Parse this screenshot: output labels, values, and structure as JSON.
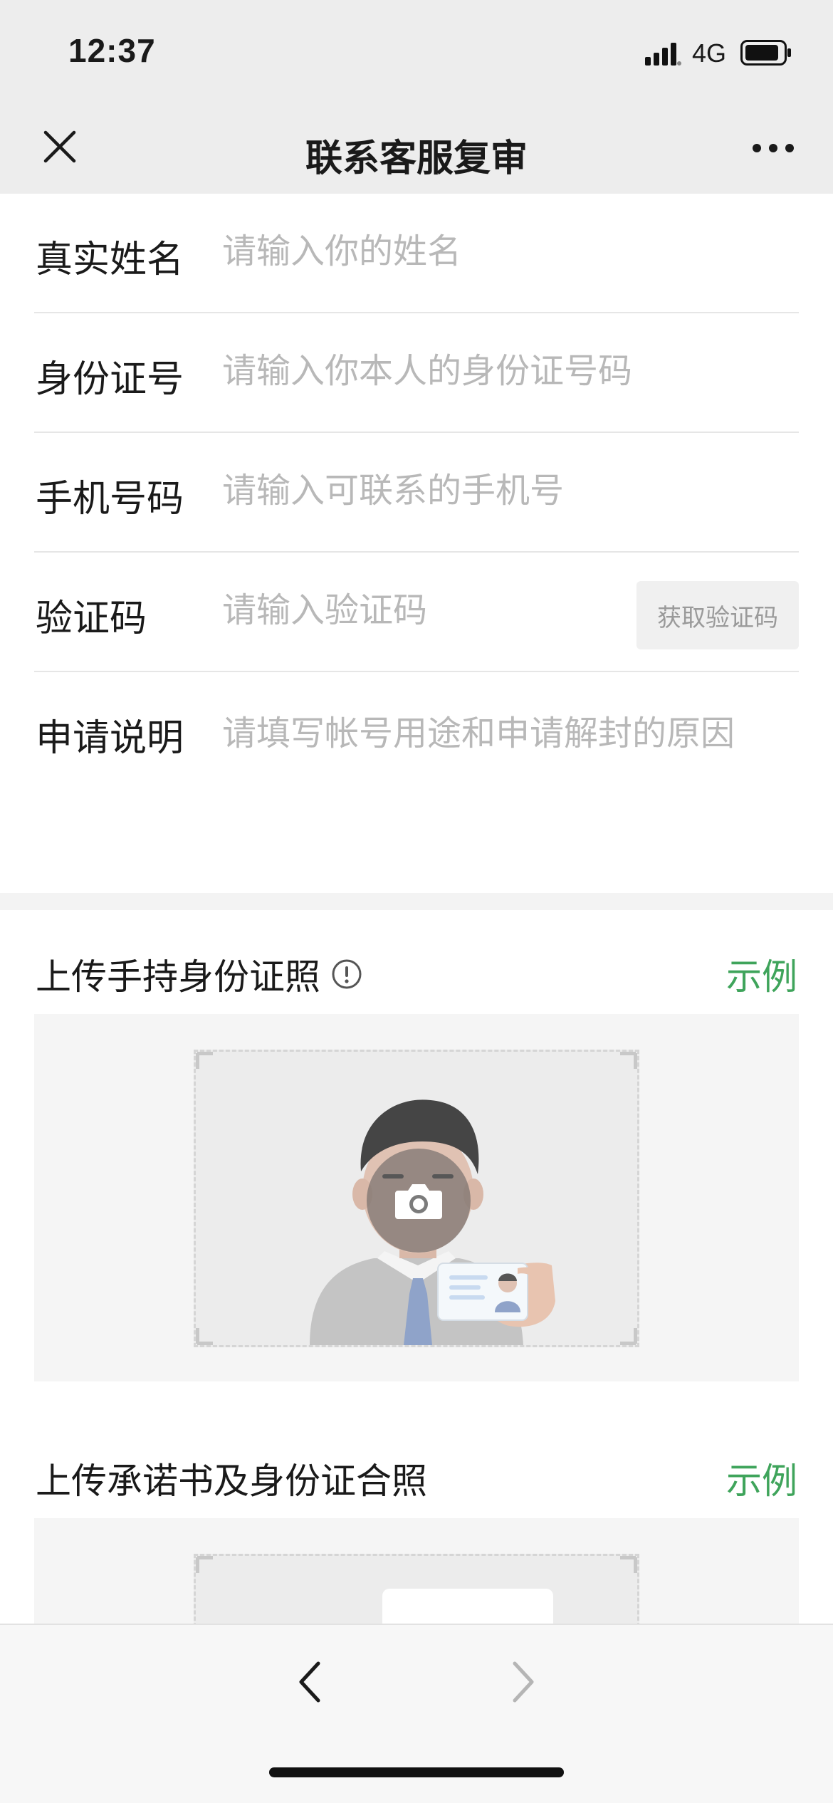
{
  "status": {
    "time": "12:37",
    "network": "4G"
  },
  "nav": {
    "title": "联系客服复审"
  },
  "form": {
    "name": {
      "label": "真实姓名",
      "placeholder": "请输入你的姓名"
    },
    "id_number": {
      "label": "身份证号",
      "placeholder": "请输入你本人的身份证号码"
    },
    "phone": {
      "label": "手机号码",
      "placeholder": "请输入可联系的手机号"
    },
    "code": {
      "label": "验证码",
      "placeholder": "请输入验证码",
      "button": "获取验证码"
    },
    "reason": {
      "label": "申请说明",
      "placeholder": "请填写帐号用途和申请解封的原因"
    }
  },
  "uploads": {
    "id_photo": {
      "title": "上传手持身份证照",
      "example": "示例"
    },
    "commitment": {
      "title": "上传承诺书及身份证合照",
      "example": "示例"
    }
  },
  "colors": {
    "accent_green": "#3fa45b",
    "nav_bg": "#ededed",
    "placeholder": "#b8b8b8"
  }
}
